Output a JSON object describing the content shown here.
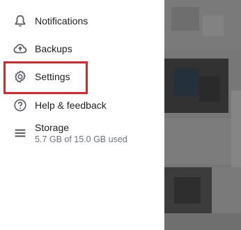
{
  "drawer": {
    "items": [
      {
        "label": "Notifications",
        "icon": "bell-icon"
      },
      {
        "label": "Backups",
        "icon": "cloud-upload-icon"
      },
      {
        "label": "Settings",
        "icon": "gear-icon"
      },
      {
        "label": "Help & feedback",
        "icon": "help-icon"
      },
      {
        "label": "Storage",
        "sublabel": "5.7 GB of 15.0 GB used",
        "icon": "storage-icon"
      }
    ]
  },
  "colors": {
    "highlight": "#e0242b",
    "text": "#202124",
    "subtext": "#70757a",
    "scrim": "#777777"
  }
}
